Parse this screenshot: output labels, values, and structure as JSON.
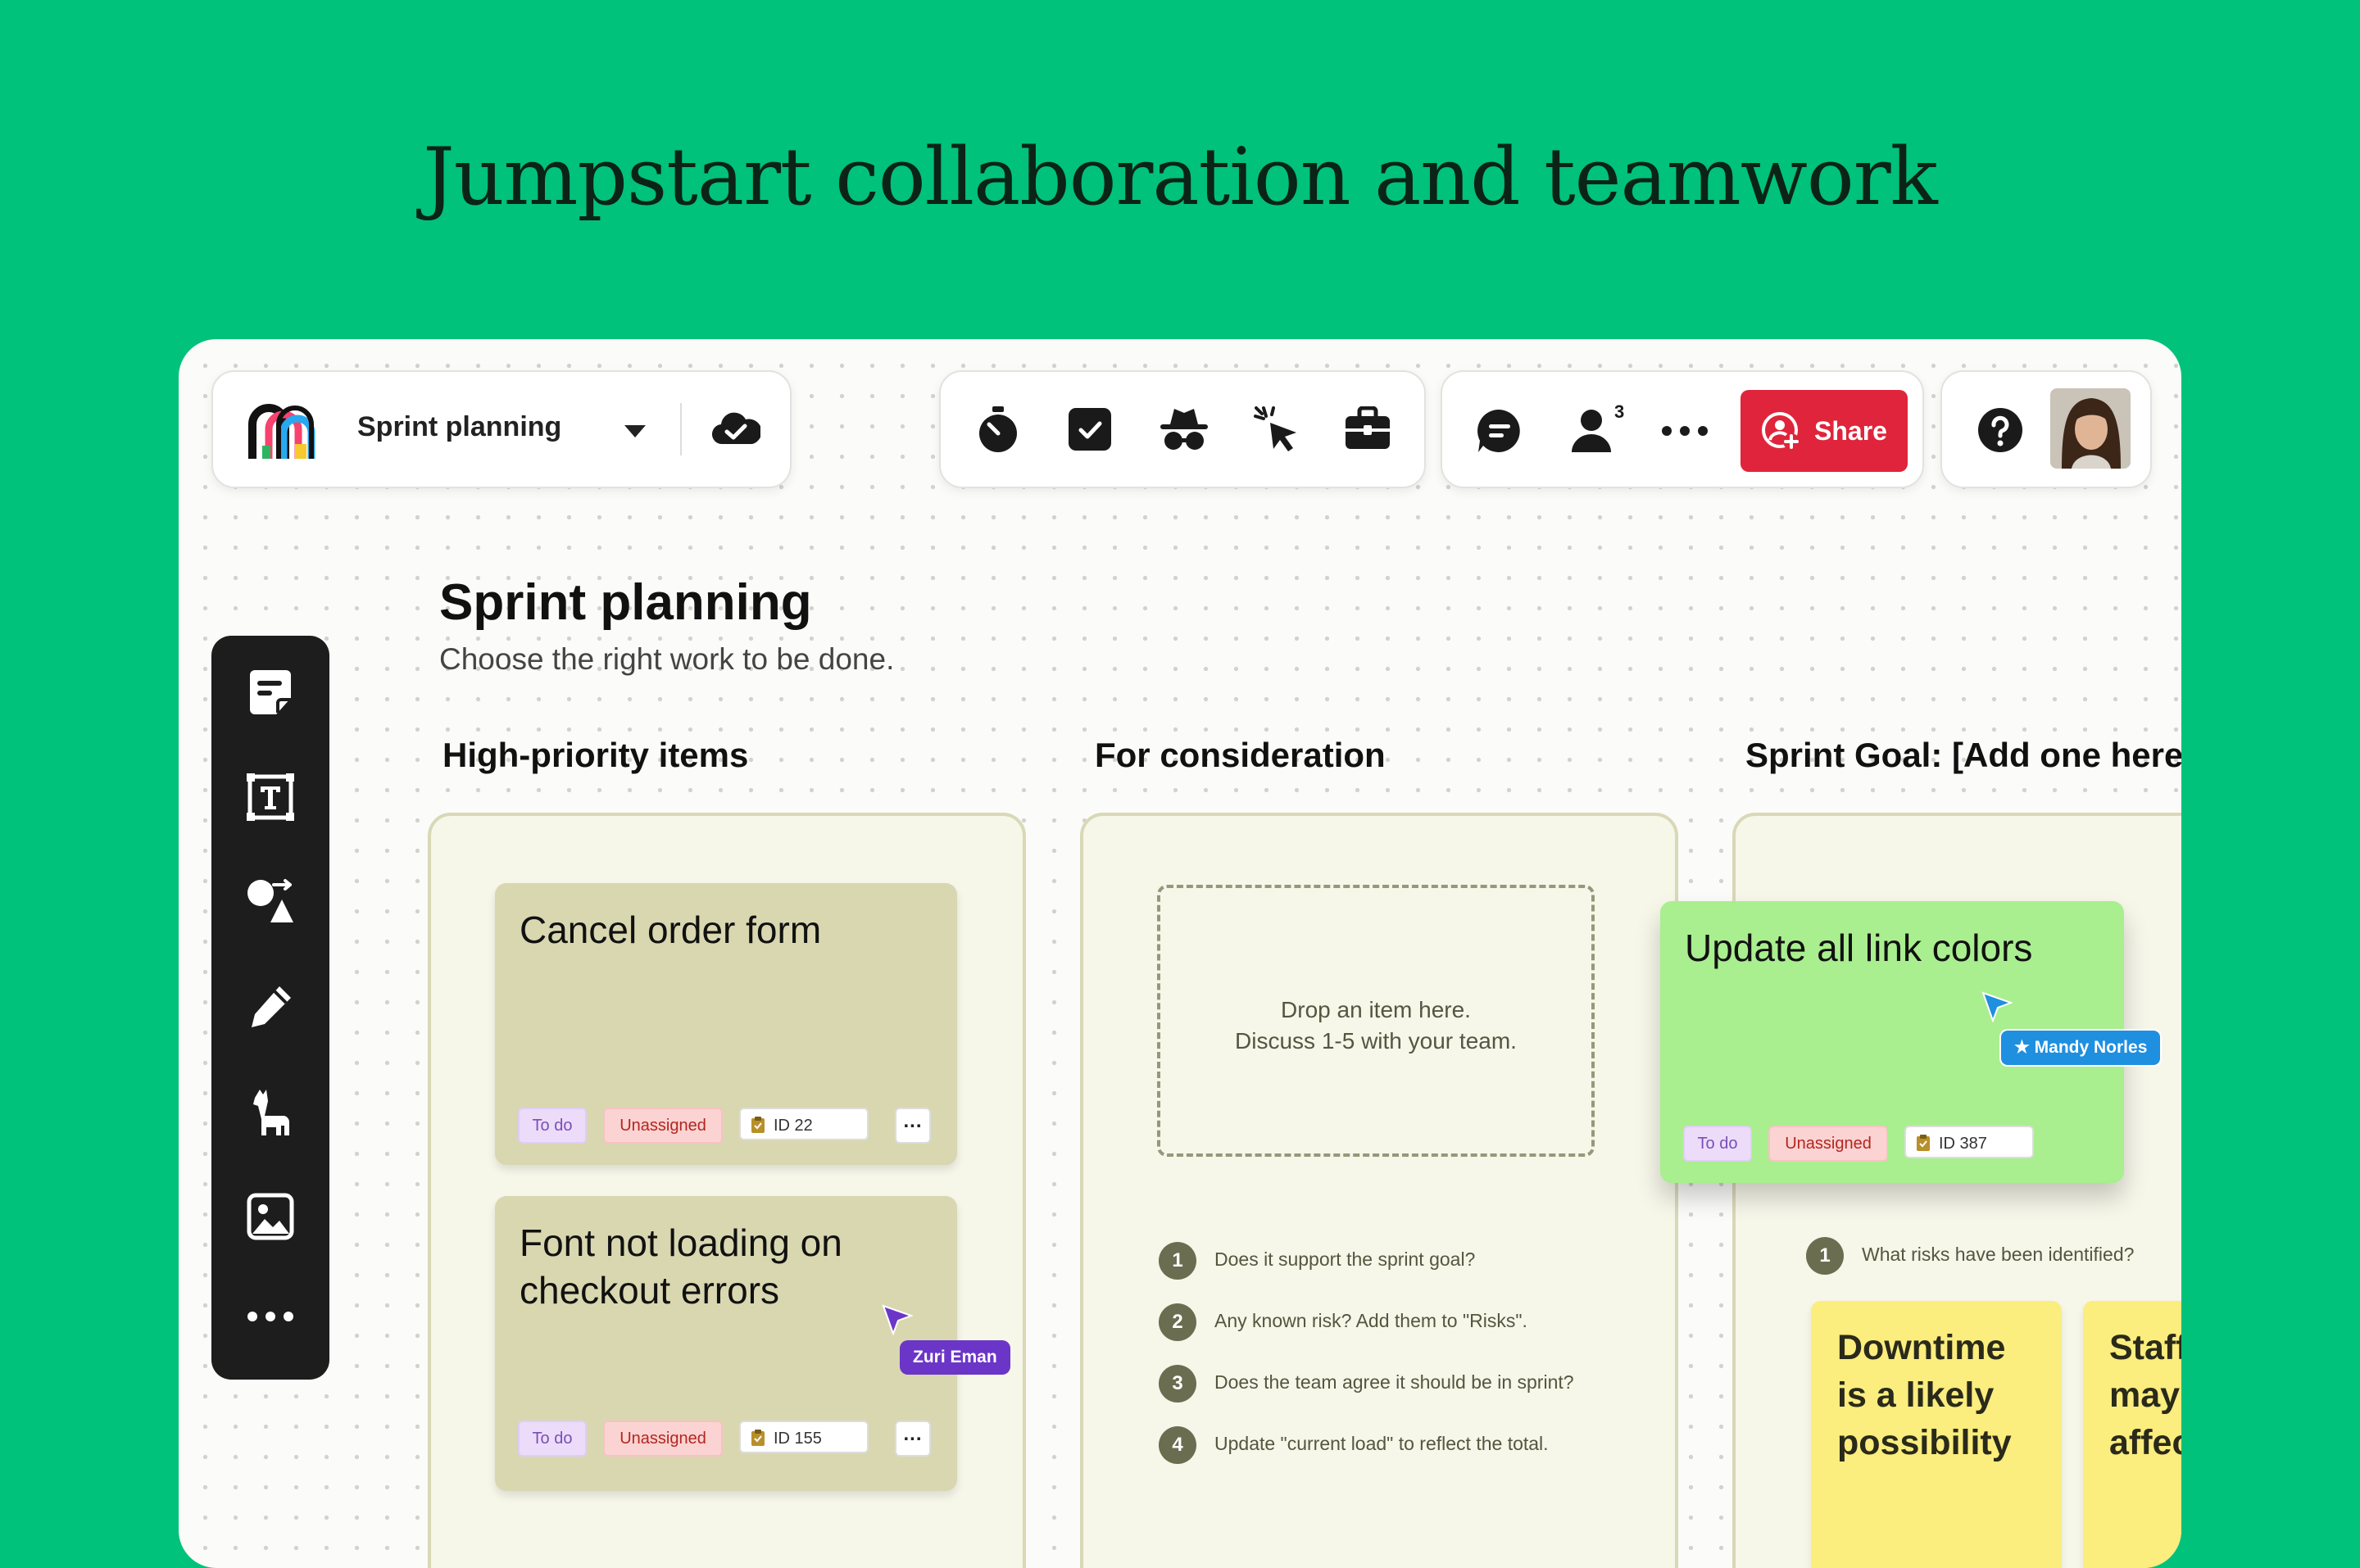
{
  "headline": "Jumpstart collaboration and teamwork",
  "toolbar": {
    "board_name": "Sprint planning",
    "share_label": "Share",
    "people_count": "3",
    "icons": [
      "stopwatch-icon",
      "checkbox-icon",
      "incognito-icon",
      "cursor-click-icon",
      "toolbox-icon",
      "comment-icon",
      "people-icon",
      "more-icon",
      "help-icon"
    ]
  },
  "sidebar": {
    "tools": [
      "sticky-note-tool",
      "text-tool",
      "shapes-tool",
      "pen-tool",
      "llama-tool",
      "image-tool",
      "more-tools"
    ]
  },
  "board": {
    "title": "Sprint planning",
    "subtitle": "Choose the right work to be done."
  },
  "columns": [
    {
      "title": "High-priority items",
      "cards": [
        {
          "title": "Cancel order form",
          "status": "To do",
          "assignee": "Unassigned",
          "id": "ID 22"
        },
        {
          "title_line1": "Font not loading on",
          "title_line2": "checkout errors",
          "status": "To do",
          "assignee": "Unassigned",
          "id": "ID 155"
        }
      ],
      "cursor": {
        "name": "Zuri Eman",
        "color": "#6b35c8"
      }
    },
    {
      "title": "For consideration",
      "dropzone_line1": "Drop an item here.",
      "dropzone_line2": "Discuss 1-5 with your team.",
      "steps": [
        {
          "n": "1",
          "text": "Does it support the sprint goal?"
        },
        {
          "n": "2",
          "text": "Any known risk? Add them to \"Risks\"."
        },
        {
          "n": "3",
          "text": "Does the team agree it should be in sprint?"
        },
        {
          "n": "4",
          "text": "Update \"current load\" to reflect the total."
        }
      ]
    },
    {
      "title": "Sprint Goal: [Add one here",
      "step": {
        "n": "1",
        "text": "What risks have been identified?"
      },
      "stickies": [
        {
          "line1": "Downtime",
          "line2": "is a likely",
          "line3": "possibility"
        },
        {
          "line1": "Staff",
          "line2": "may",
          "line3": "affec"
        }
      ]
    }
  ],
  "dragged_card": {
    "title": "Update all link colors",
    "status": "To do",
    "assignee": "Unassigned",
    "id": "ID 387"
  },
  "cursor2": {
    "name": "Mandy Norles",
    "color": "#1f8fe0"
  },
  "colors": {
    "background": "#00c27a",
    "share": "#e0243b",
    "card": "#d8d7b0",
    "dragged_card": "#a9ee8f",
    "sticky": "#fbed7e"
  }
}
